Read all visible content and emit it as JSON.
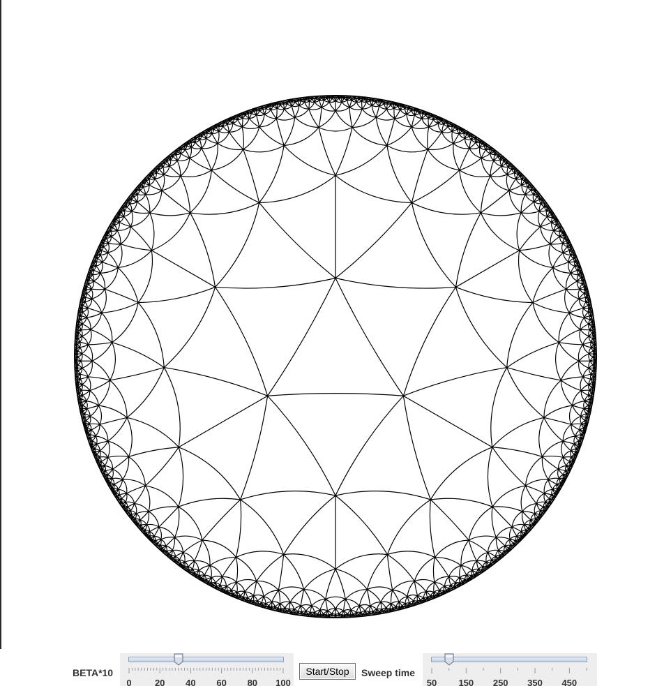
{
  "controls": {
    "beta": {
      "label": "BETA*10",
      "min": 0,
      "max": 100,
      "value": 32,
      "tick_labels": [
        "0",
        "20",
        "40",
        "60",
        "80",
        "100"
      ]
    },
    "start_stop_label": "Start/Stop",
    "sweep": {
      "label": "Sweep time",
      "min": 50,
      "max": 500,
      "value": 100,
      "tick_labels": [
        "50",
        "150",
        "250",
        "350",
        "450"
      ]
    }
  },
  "colors": {
    "background": "#ffffff",
    "mesh_line": "#000000",
    "slider_panel": "#eeeeee",
    "label_text": "#333333"
  },
  "icons": {
    "slider_thumb": "slider-thumb-icon"
  }
}
